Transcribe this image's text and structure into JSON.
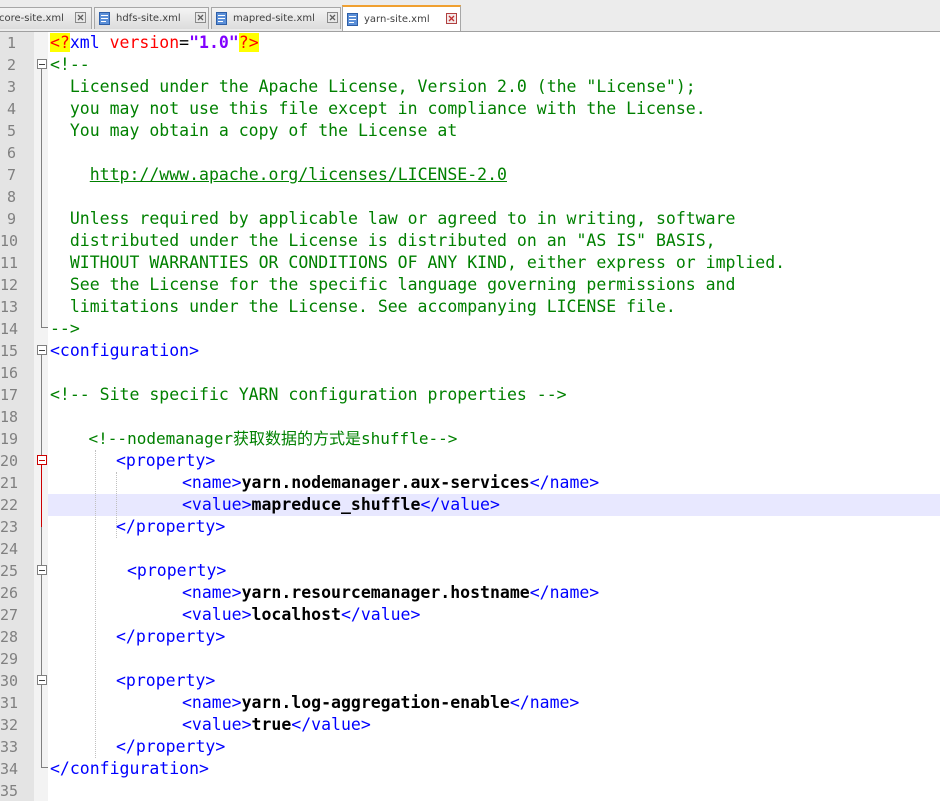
{
  "tabs": [
    {
      "label": "core-site.xml",
      "active": false
    },
    {
      "label": "hdfs-site.xml",
      "active": false
    },
    {
      "label": "mapred-site.xml",
      "active": false
    },
    {
      "label": "yarn-site.xml",
      "active": true
    }
  ],
  "line_numbers": [
    "1",
    "2",
    "3",
    "4",
    "5",
    "6",
    "7",
    "8",
    "9",
    "10",
    "11",
    "12",
    "13",
    "14",
    "15",
    "16",
    "17",
    "18",
    "19",
    "20",
    "21",
    "22",
    "23",
    "24",
    "25",
    "26",
    "27",
    "28",
    "29",
    "30",
    "31",
    "32",
    "33",
    "34",
    "35"
  ],
  "code": {
    "l1": {
      "pi_open": "<?",
      "xml": "xml ",
      "attr": "version",
      "eq": "=",
      "val": "\"1.0\"",
      "pi_close": "?>"
    },
    "l2": "<!--",
    "l3": "  Licensed under the Apache License, Version 2.0 (the \"License\");",
    "l4": "  you may not use this file except in compliance with the License.",
    "l5": "  You may obtain a copy of the License at",
    "l7_indent": "    ",
    "l7_url": "http://www.apache.org/licenses/LICENSE-2.0",
    "l9": "  Unless required by applicable law or agreed to in writing, software",
    "l10": "  distributed under the License is distributed on an \"AS IS\" BASIS,",
    "l11": "  WITHOUT WARRANTIES OR CONDITIONS OF ANY KIND, either express or implied.",
    "l12": "  See the License for the specific language governing permissions and",
    "l13": "  limitations under the License. See accompanying LICENSE file.",
    "l14": "-->",
    "l15": "<configuration>",
    "l17": "<!-- Site specific YARN configuration properties -->",
    "l19": "    <!--nodemanager获取数据的方式是shuffle-->",
    "prop_open": "<property>",
    "prop_close": "</property>",
    "name_open": "<name>",
    "name_close": "</name>",
    "value_open": "<value>",
    "value_close": "</value>",
    "p1_name": "yarn.nodemanager.aux-services",
    "p1_value": "mapreduce_shuffle",
    "p2_name": "yarn.resourcemanager.hostname",
    "p2_value": "localhost",
    "p3_name": "yarn.log-aggregation-enable",
    "p3_value": "true",
    "l34": "</configuration>"
  },
  "colors": {
    "comment": "#008000",
    "tag": "#0000ff",
    "attribute": "#ff0000",
    "attr_value": "#8000ff",
    "current_line": "#e8e8ff",
    "gutter": "#e4e4e4"
  },
  "icons": {
    "file": "file-icon",
    "close": "close-icon"
  }
}
